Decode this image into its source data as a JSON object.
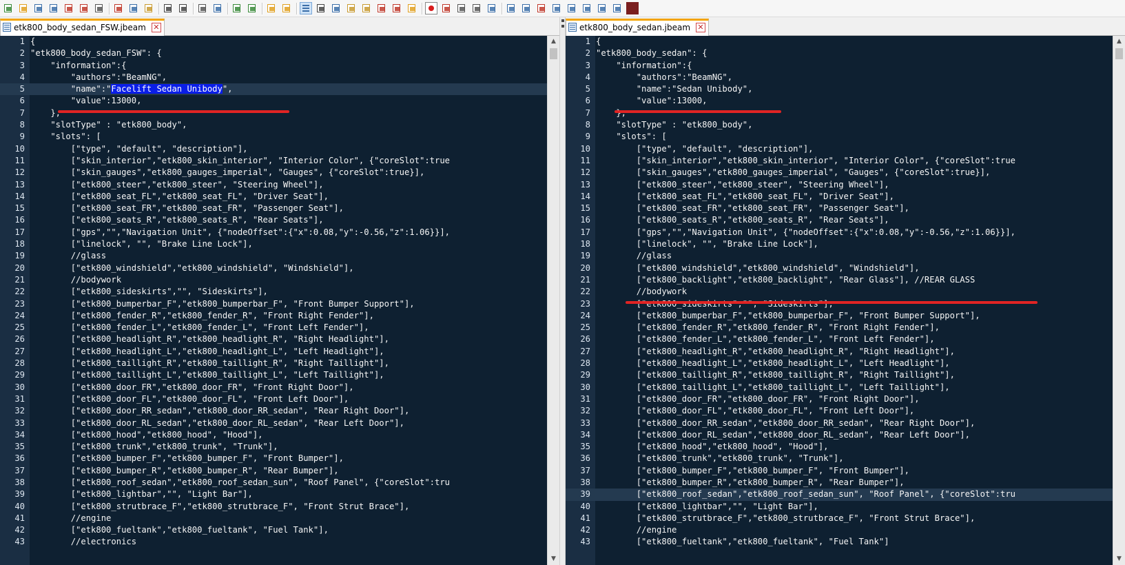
{
  "toolbar": {
    "groups": [
      [
        "new-icon",
        "open-icon",
        "save-icon",
        "save-all-icon",
        "close-icon",
        "close-all-icon",
        "print-icon"
      ],
      [
        "cut-icon",
        "copy-icon",
        "paste-icon"
      ],
      [
        "undo-icon",
        "redo-icon"
      ],
      [
        "find-icon",
        "replace-icon"
      ],
      [
        "zoom-in-icon",
        "zoom-out-icon"
      ],
      [
        "sync-vertical-icon",
        "sync-horizontal-icon"
      ],
      [
        "word-wrap-icon",
        "show-all-chars-icon",
        "indent-guide-icon",
        "user-language-icon",
        "document-map-icon",
        "function-list-icon",
        "folder-workspace-icon",
        "monitoring-icon"
      ],
      [
        "record-macro-icon",
        "stop-macro-icon",
        "play-macro-icon",
        "run-macro-multiple-icon",
        "save-macro-icon"
      ],
      [
        "compare-icon",
        "compare-prev-icon",
        "compare-clear-icon",
        "compare-align-icon",
        "compare-up-icon",
        "compare-down-icon",
        "compare-first-icon",
        "compare-navigation-icon",
        "spellcheck-icon"
      ]
    ],
    "spellcheck_label": "ABC"
  },
  "left": {
    "tab_title": "etk800_body_sedan_FSW.jbeam",
    "lines": [
      "{",
      "\"etk800_body_sedan_FSW\": {",
      "    \"information\":{",
      "        \"authors\":\"BeamNG\",",
      "        \"name\":\"Facelift Sedan Unibody\",",
      "        \"value\":13000,",
      "    },",
      "    \"slotType\" : \"etk800_body\",",
      "    \"slots\": [",
      "        [\"type\", \"default\", \"description\"],",
      "        [\"skin_interior\",\"etk800_skin_interior\", \"Interior Color\", {\"coreSlot\":true",
      "        [\"skin_gauges\",\"etk800_gauges_imperial\", \"Gauges\", {\"coreSlot\":true}],",
      "        [\"etk800_steer\",\"etk800_steer\", \"Steering Wheel\"],",
      "        [\"etk800_seat_FL\",\"etk800_seat_FL\", \"Driver Seat\"],",
      "        [\"etk800_seat_FR\",\"etk800_seat_FR\", \"Passenger Seat\"],",
      "        [\"etk800_seats_R\",\"etk800_seats_R\", \"Rear Seats\"],",
      "        [\"gps\",\"\",\"Navigation Unit\", {\"nodeOffset\":{\"x\":0.08,\"y\":-0.56,\"z\":1.06}}],",
      "        [\"linelock\", \"\", \"Brake Line Lock\"],",
      "        //glass",
      "        [\"etk800_windshield\",\"etk800_windshield\", \"Windshield\"],",
      "        //bodywork",
      "        [\"etk800_sideskirts\",\"\", \"Sideskirts\"],",
      "        [\"etk800_bumperbar_F\",\"etk800_bumperbar_F\", \"Front Bumper Support\"],",
      "        [\"etk800_fender_R\",\"etk800_fender_R\", \"Front Right Fender\"],",
      "        [\"etk800_fender_L\",\"etk800_fender_L\", \"Front Left Fender\"],",
      "        [\"etk800_headlight_R\",\"etk800_headlight_R\", \"Right Headlight\"],",
      "        [\"etk800_headlight_L\",\"etk800_headlight_L\", \"Left Headlight\"],",
      "        [\"etk800_taillight_R\",\"etk800_taillight_R\", \"Right Taillight\"],",
      "        [\"etk800_taillight_L\",\"etk800_taillight_L\", \"Left Taillight\"],",
      "        [\"etk800_door_FR\",\"etk800_door_FR\", \"Front Right Door\"],",
      "        [\"etk800_door_FL\",\"etk800_door_FL\", \"Front Left Door\"],",
      "        [\"etk800_door_RR_sedan\",\"etk800_door_RR_sedan\", \"Rear Right Door\"],",
      "        [\"etk800_door_RL_sedan\",\"etk800_door_RL_sedan\", \"Rear Left Door\"],",
      "        [\"etk800_hood\",\"etk800_hood\", \"Hood\"],",
      "        [\"etk800_trunk\",\"etk800_trunk\", \"Trunk\"],",
      "        [\"etk800_bumper_F\",\"etk800_bumper_F\", \"Front Bumper\"],",
      "        [\"etk800_bumper_R\",\"etk800_bumper_R\", \"Rear Bumper\"],",
      "        [\"etk800_roof_sedan\",\"etk800_roof_sedan_sun\", \"Roof Panel\", {\"coreSlot\":tru",
      "        [\"etk800_lightbar\",\"\", \"Light Bar\"],",
      "        [\"etk800_strutbrace_F\",\"etk800_strutbrace_F\", \"Front Strut Brace\"],",
      "        //engine",
      "        [\"etk800_fueltank\",\"etk800_fueltank\", \"Fuel Tank\"],",
      "        //electronics"
    ]
  },
  "right": {
    "tab_title": "etk800_body_sedan.jbeam",
    "lines": [
      "{",
      "\"etk800_body_sedan\": {",
      "    \"information\":{",
      "        \"authors\":\"BeamNG\",",
      "        \"name\":\"Sedan Unibody\",",
      "        \"value\":13000,",
      "    },",
      "    \"slotType\" : \"etk800_body\",",
      "    \"slots\": [",
      "        [\"type\", \"default\", \"description\"],",
      "        [\"skin_interior\",\"etk800_skin_interior\", \"Interior Color\", {\"coreSlot\":true",
      "        [\"skin_gauges\",\"etk800_gauges_imperial\", \"Gauges\", {\"coreSlot\":true}],",
      "        [\"etk800_steer\",\"etk800_steer\", \"Steering Wheel\"],",
      "        [\"etk800_seat_FL\",\"etk800_seat_FL\", \"Driver Seat\"],",
      "        [\"etk800_seat_FR\",\"etk800_seat_FR\", \"Passenger Seat\"],",
      "        [\"etk800_seats_R\",\"etk800_seats_R\", \"Rear Seats\"],",
      "        [\"gps\",\"\",\"Navigation Unit\", {\"nodeOffset\":{\"x\":0.08,\"y\":-0.56,\"z\":1.06}}],",
      "        [\"linelock\", \"\", \"Brake Line Lock\"],",
      "        //glass",
      "        [\"etk800_windshield\",\"etk800_windshield\", \"Windshield\"],",
      "        [\"etk800_backlight\",\"etk800_backlight\", \"Rear Glass\"], //REAR GLASS",
      "        //bodywork",
      "        [\"etk800_sideskirts\",\"\", \"Sideskirts\"],",
      "        [\"etk800_bumperbar_F\",\"etk800_bumperbar_F\", \"Front Bumper Support\"],",
      "        [\"etk800_fender_R\",\"etk800_fender_R\", \"Front Right Fender\"],",
      "        [\"etk800_fender_L\",\"etk800_fender_L\", \"Front Left Fender\"],",
      "        [\"etk800_headlight_R\",\"etk800_headlight_R\", \"Right Headlight\"],",
      "        [\"etk800_headlight_L\",\"etk800_headlight_L\", \"Left Headlight\"],",
      "        [\"etk800_taillight_R\",\"etk800_taillight_R\", \"Right Taillight\"],",
      "        [\"etk800_taillight_L\",\"etk800_taillight_L\", \"Left Taillight\"],",
      "        [\"etk800_door_FR\",\"etk800_door_FR\", \"Front Right Door\"],",
      "        [\"etk800_door_FL\",\"etk800_door_FL\", \"Front Left Door\"],",
      "        [\"etk800_door_RR_sedan\",\"etk800_door_RR_sedan\", \"Rear Right Door\"],",
      "        [\"etk800_door_RL_sedan\",\"etk800_door_RL_sedan\", \"Rear Left Door\"],",
      "        [\"etk800_hood\",\"etk800_hood\", \"Hood\"],",
      "        [\"etk800_trunk\",\"etk800_trunk\", \"Trunk\"],",
      "        [\"etk800_bumper_F\",\"etk800_bumper_F\", \"Front Bumper\"],",
      "        [\"etk800_bumper_R\",\"etk800_bumper_R\", \"Rear Bumper\"],",
      "        [\"etk800_roof_sedan\",\"etk800_roof_sedan_sun\", \"Roof Panel\", {\"coreSlot\":tru",
      "        [\"etk800_lightbar\",\"\", \"Light Bar\"],",
      "        [\"etk800_strutbrace_F\",\"etk800_strutbrace_F\", \"Front Strut Brace\"],",
      "        //engine",
      "        [\"etk800_fueltank\",\"etk800_fueltank\", \"Fuel Tank\"]"
    ]
  },
  "colors": {
    "editor_bg": "#0e2031",
    "gutter_bg": "#1a2e43",
    "text": "#f5f5f5",
    "selection": "#0a1ee8",
    "current_line": "#243a50",
    "annotation_red": "#e02424",
    "tab_accent": "#f3a400"
  }
}
